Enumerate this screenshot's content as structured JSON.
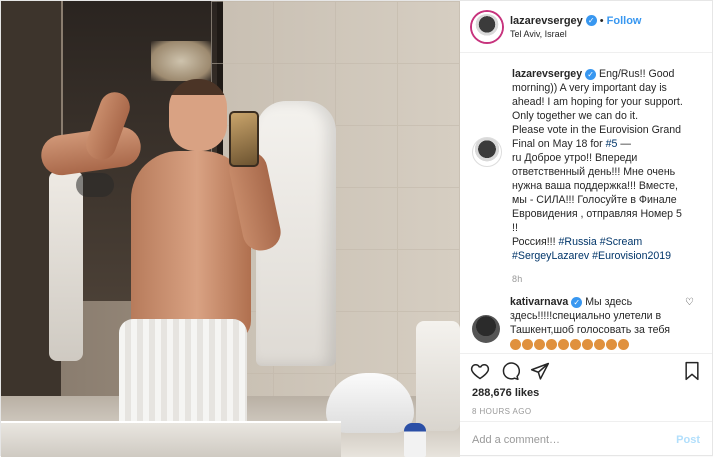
{
  "header": {
    "username": "lazarevsergey",
    "separator": "•",
    "follow_label": "Follow",
    "location": "Tel Aviv, Israel"
  },
  "caption": {
    "username": "lazarevsergey",
    "lines": [
      "Eng/Rus!! Good",
      "morning)) A very important day is",
      "ahead! I am hoping for your support.",
      "Only together we can do it.",
      "Please vote in the Eurovision Grand",
      "Final on May 18 for",
      "ru Доброе утро!! Впереди",
      "ответственный день!!! Мне очень",
      "нужна ваша поддержка!!! Вместе,",
      "мы - СИЛА!!! Голосуйте в Финале",
      "Евровидения , отправляя Номер 5 !!",
      "Россия!!!"
    ],
    "number_tag": "#5",
    "dash": "—",
    "tags": [
      "#Russia",
      "#Scream",
      "#SergeyLazarev",
      "#Eurovision2019"
    ],
    "time": "8h"
  },
  "comment": {
    "username": "kativarnava",
    "text_line1": "Мы здесь",
    "text_line2": "здесь!!!!!специально улетели в",
    "text_line3": "Ташкент,шоб голосовать за тебя",
    "emoji_count": 10
  },
  "likes": "288,676 likes",
  "posted": "8 HOURS AGO",
  "add_comment": {
    "placeholder": "Add a comment…",
    "post_label": "Post"
  },
  "colors": {
    "accent": "#3897f0",
    "post_disabled": "#b2dffc",
    "hashtag": "#003569"
  },
  "icons": [
    "verified-badge-icon",
    "heart-icon",
    "comment-icon",
    "share-icon",
    "bookmark-icon"
  ]
}
